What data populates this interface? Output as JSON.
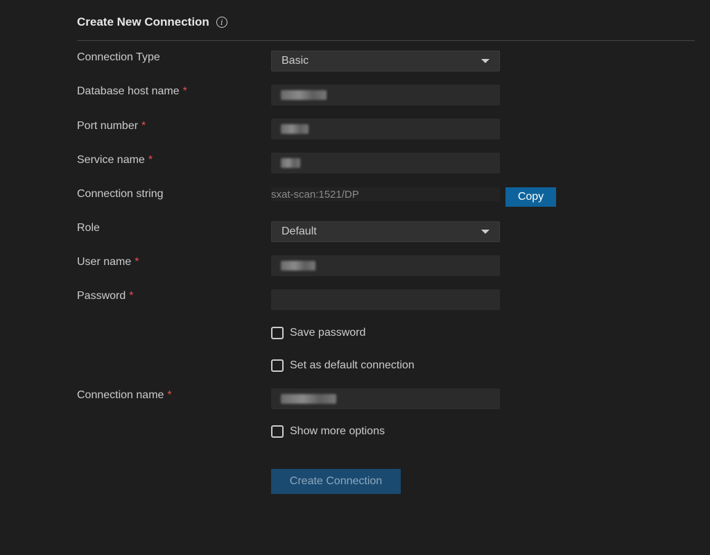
{
  "header": {
    "title": "Create New Connection",
    "info_icon": "info-icon"
  },
  "required_marker": "*",
  "form": {
    "connection_type": {
      "label": "Connection Type",
      "value": "Basic",
      "icon": "chevron-down-icon"
    },
    "host": {
      "label": "Database host name"
    },
    "port": {
      "label": "Port number"
    },
    "service": {
      "label": "Service name"
    },
    "connection_string": {
      "label": "Connection string",
      "value": "sxat-scan:1521/DP",
      "copy_label": "Copy"
    },
    "role": {
      "label": "Role",
      "value": "Default",
      "icon": "chevron-down-icon"
    },
    "user": {
      "label": "User name"
    },
    "password": {
      "label": "Password"
    },
    "save_password": {
      "label": "Save password",
      "checked": false
    },
    "default_connection": {
      "label": "Set as default connection",
      "checked": false
    },
    "connection_name": {
      "label": "Connection name"
    },
    "more_options": {
      "label": "Show more options",
      "checked": false
    },
    "submit_label": "Create Connection"
  },
  "colors": {
    "background": "#1e1e1e",
    "accent": "#0e639c",
    "required": "#f14c4c"
  }
}
